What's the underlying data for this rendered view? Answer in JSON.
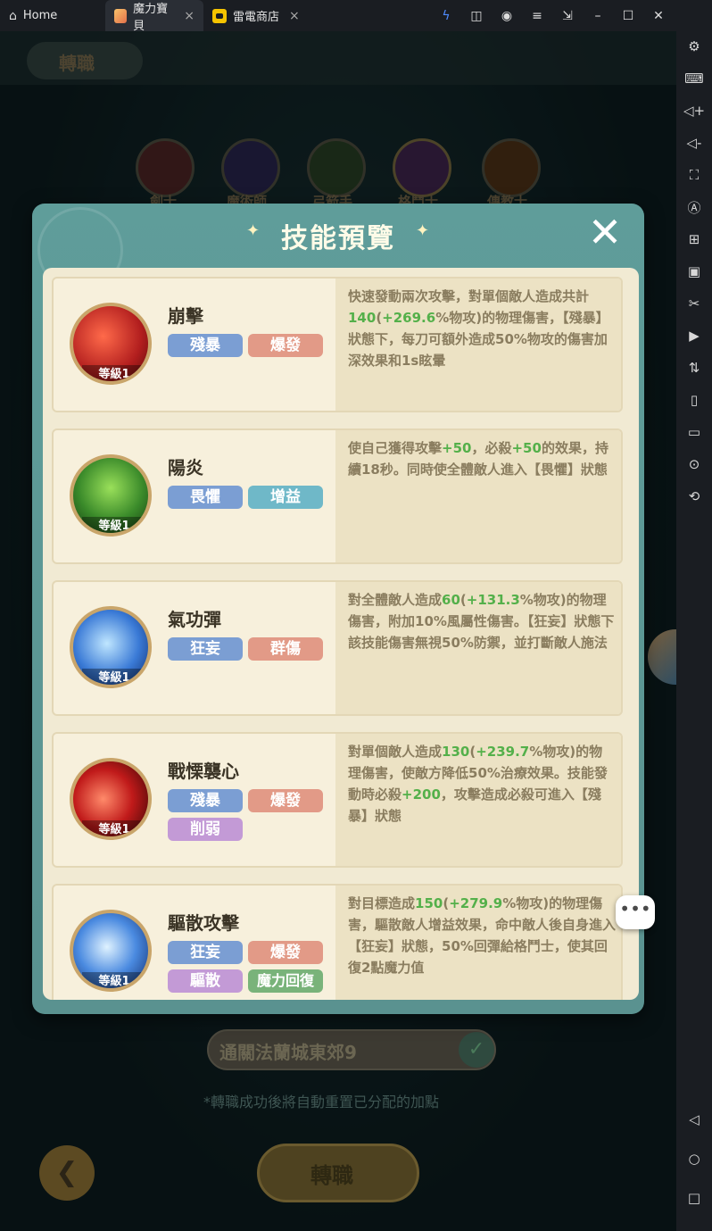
{
  "titlebar": {
    "tabs": [
      {
        "label": "Home"
      },
      {
        "label": "魔力寶貝"
      },
      {
        "label": "雷電商店"
      }
    ]
  },
  "game": {
    "header_title": "轉職",
    "classes": [
      "劍士",
      "魔術師",
      "弓箭手",
      "格鬥士",
      "傳教士"
    ],
    "condition": "通關法蘭城東郊9",
    "note": "*轉職成功後將自動重置已分配的加點",
    "main_button": "轉職"
  },
  "modal": {
    "title": "技能預覽",
    "skills": [
      {
        "name": "崩擊",
        "level": "等級1",
        "tags": [
          "殘暴",
          "爆發"
        ],
        "desc_parts": [
          "快速發動兩次攻擊，對單個敵人造成共計",
          "140",
          "(",
          "+269.6",
          "%物攻)的物理傷害，【殘暴】狀態下，每刀可額外造成50%物攻的傷害加深效果和1s眩暈"
        ]
      },
      {
        "name": "陽炎",
        "level": "等級1",
        "tags": [
          "畏懼",
          "增益"
        ],
        "desc_parts": [
          "使自己獲得攻擊",
          "+50",
          "，必殺",
          "+50",
          "的效果，持續18秒。同時使全體敵人進入【畏懼】狀態"
        ]
      },
      {
        "name": "氣功彈",
        "level": "等級1",
        "tags": [
          "狂妄",
          "群傷"
        ],
        "desc_parts": [
          "對全體敵人造成",
          "60",
          "(",
          "+131.3",
          "%物攻)的物理傷害，附加10%風屬性傷害。【狂妄】狀態下該技能傷害無視50%防禦，並打斷敵人施法"
        ]
      },
      {
        "name": "戰慄襲心",
        "level": "等級1",
        "tags": [
          "殘暴",
          "爆發",
          "削弱"
        ],
        "desc_parts": [
          "對單個敵人造成",
          "130",
          "(",
          "+239.7",
          "%物攻)的物理傷害，使敵方降低50%治療效果。技能發動時必殺",
          "+200",
          "，攻擊造成必殺可進入【殘暴】狀態"
        ]
      },
      {
        "name": "驅散攻擊",
        "level": "等級1",
        "tags": [
          "狂妄",
          "爆發",
          "驅散",
          "魔力回復"
        ],
        "desc_parts": [
          "對目標造成",
          "150",
          "(",
          "+279.9",
          "%物攻)的物理傷害，驅散敵人增益效果，命中敵人後自身進入【狂妄】狀態，50%回彈給格鬥士，使其回復2點魔力值"
        ]
      }
    ]
  },
  "colors": {
    "highlight": "#54b04a",
    "tag_blue": "#7b9ed3",
    "tag_red": "#e29a87",
    "tag_teal": "#6fb8c8",
    "tag_purple": "#c39ad6",
    "tag_green": "#79b37a"
  },
  "icons": [
    "home-icon",
    "bolt-icon",
    "gamepad-icon",
    "account-icon",
    "menu-icon",
    "resize-icon",
    "minimize-icon",
    "maximize-icon",
    "close-icon",
    "collapse-icon"
  ]
}
